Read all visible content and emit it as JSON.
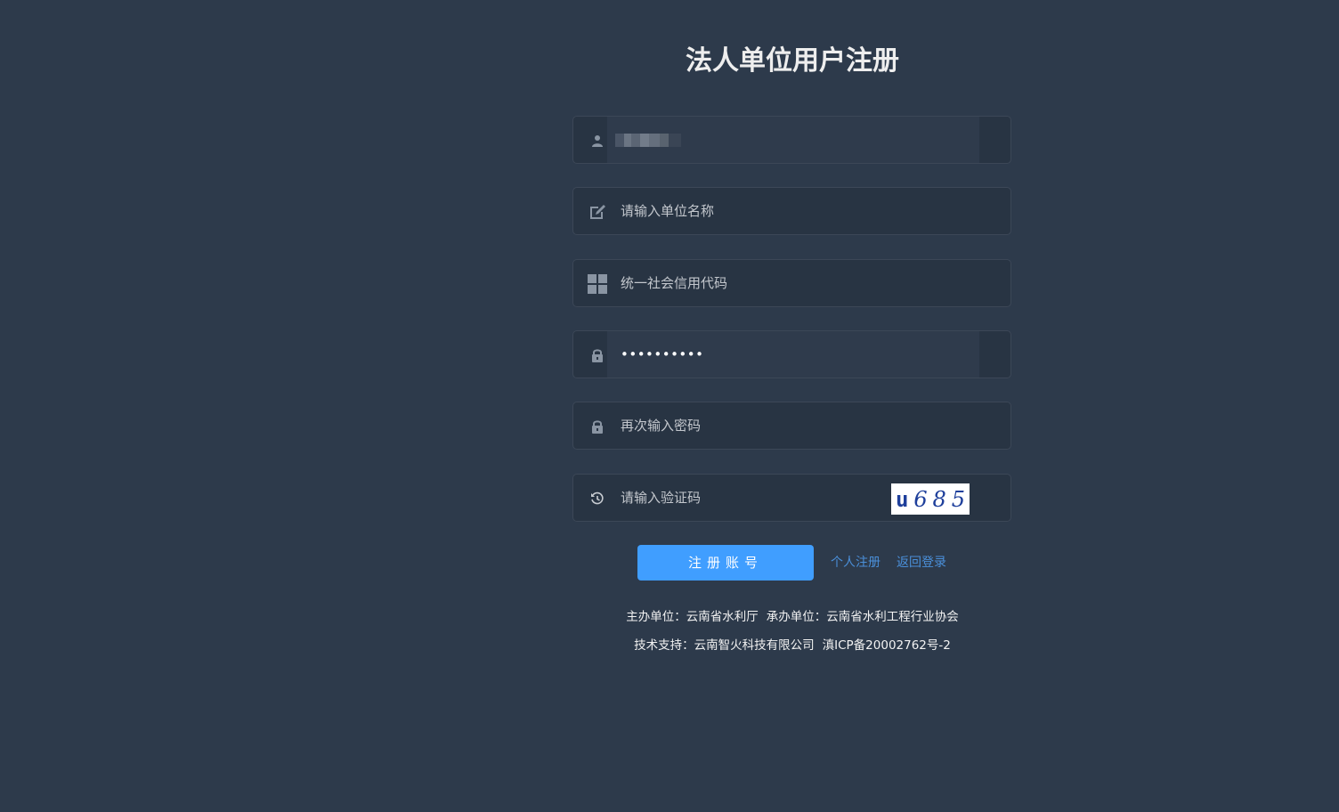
{
  "title": "法人单位用户注册",
  "form": {
    "username": {
      "value": "",
      "icon": "user-icon"
    },
    "org_name": {
      "placeholder": "请输入单位名称",
      "icon": "edit-icon"
    },
    "credit_code": {
      "placeholder": "统一社会信用代码",
      "icon": "grid-icon"
    },
    "password": {
      "value": "••••••••••",
      "icon": "lock-icon"
    },
    "confirm_password": {
      "placeholder": "再次输入密码",
      "icon": "lock-icon"
    },
    "captcha": {
      "placeholder": "请输入验证码",
      "icon": "history-icon",
      "image_chars": [
        "u",
        "6",
        "8",
        "5"
      ]
    }
  },
  "actions": {
    "submit_label": "注册账号",
    "personal_register_label": "个人注册",
    "back_login_label": "返回登录"
  },
  "footer": {
    "host": "主办单位：云南省水利厅",
    "organizer": "承办单位：云南省水利工程行业协会",
    "tech_support": "技术支持：云南智火科技有限公司",
    "icp": "滇ICP备20002762号-2"
  },
  "colors": {
    "background": "#2d3a4b",
    "field_bg": "#283443",
    "primary": "#409eff",
    "link": "#4a8fd9"
  }
}
